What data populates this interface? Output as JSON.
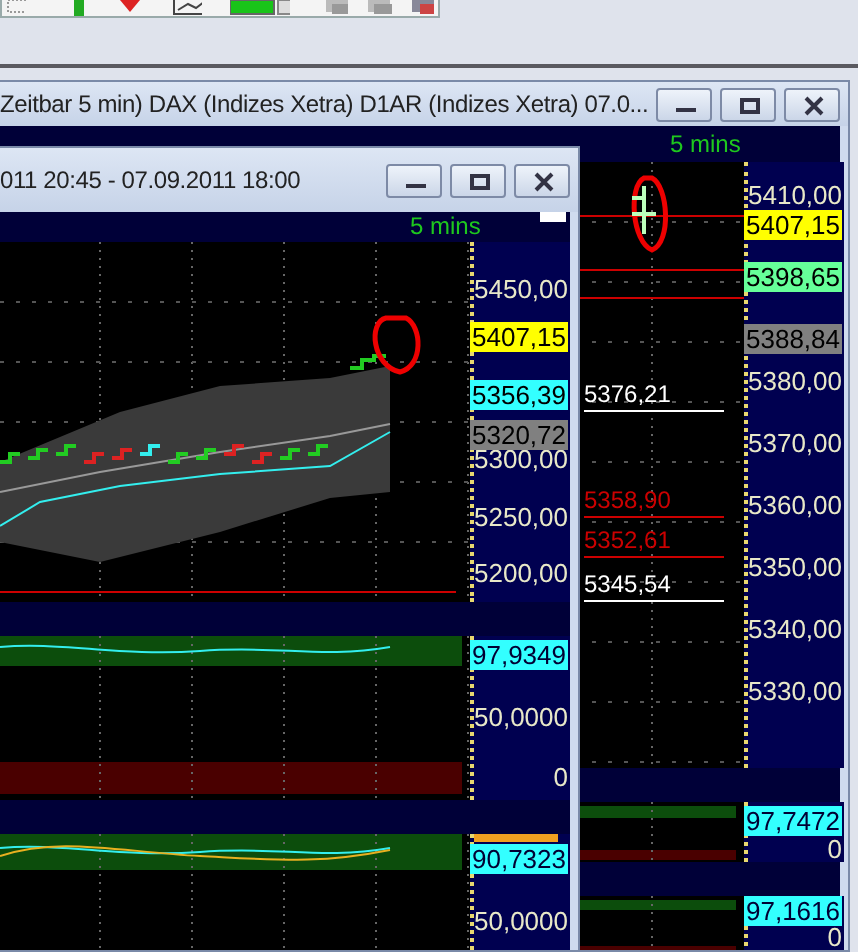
{
  "back_window": {
    "title": "Zeitbar 5 min)  DAX (Indizes Xetra) D1AR (Indizes Xetra) 07.0...",
    "interval": "5 mins",
    "price_axis": [
      "5410,00",
      "5380,00",
      "5370,00",
      "5360,00",
      "5350,00",
      "5340,00",
      "5330,00"
    ],
    "markers": [
      {
        "text": "5407,15",
        "color": "#ffff00"
      },
      {
        "text": "5398,65",
        "color": "#66ff99"
      },
      {
        "text": "5388,84",
        "color": "#808080"
      }
    ],
    "levels": [
      {
        "text": "5376,21",
        "color": "#ffffff"
      },
      {
        "text": "5358,90",
        "color": "#cc0000"
      },
      {
        "text": "5352,61",
        "color": "#cc0000"
      },
      {
        "text": "5345,54",
        "color": "#ffffff"
      }
    ],
    "oscillators": [
      {
        "value": "97,7472",
        "zero": "0"
      },
      {
        "value": "97,1616",
        "zero": "0"
      }
    ]
  },
  "front_window": {
    "title": "011 20:45 - 07.09.2011 18:00",
    "interval": "5 mins",
    "price_axis": [
      "5450,00",
      "5300,00",
      "5250,00",
      "5200,00"
    ],
    "markers": [
      {
        "text": "5407,15",
        "color": "#ffff00"
      },
      {
        "text": "5356,39",
        "color": "#33ffff"
      },
      {
        "text": "5320,72",
        "color": "#808080"
      }
    ],
    "oscillators": [
      {
        "value": "97,9349",
        "mid": "50,0000",
        "zero": "0"
      },
      {
        "value": "90,7323",
        "mid": "50,0000"
      }
    ]
  }
}
